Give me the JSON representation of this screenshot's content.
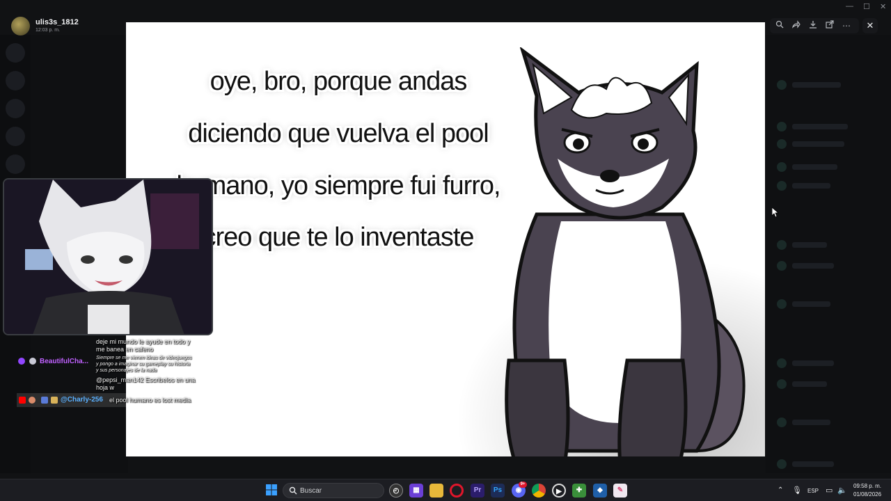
{
  "viewer": {
    "uploader_name": "ulis3s_1812",
    "uploader_time": "12:03 p. m.",
    "actions": [
      "zoom-icon",
      "forward-icon",
      "download-icon",
      "open-external-icon",
      "more-icon"
    ],
    "close_icon": "close-icon"
  },
  "media": {
    "caption_lines": [
      "oye, bro, porque andas",
      "diciendo que vuelva el pool",
      "humano, yo siempre fui furro,",
      "creo que te lo inventaste"
    ]
  },
  "chat": {
    "messages": [
      {
        "text": "deje mi mundo le ayude en todo y"
      },
      {
        "text": "me banea en cafeno"
      },
      {
        "user": "BeautifulCha...",
        "user_color": "#c061ff"
      },
      {
        "text": "Siempre se me vienen ideas de videojuegos"
      },
      {
        "text": "y pongo a imaginar su gameplay su historia"
      },
      {
        "text": "y sus personajes de la nada"
      },
      {
        "text": "@pepsi_man142 Escribelos en una"
      },
      {
        "text": "hoja w"
      },
      {
        "user": "@Charly-256",
        "user_color": "#5ab0ff",
        "text": "el pool humano es lost media"
      }
    ]
  },
  "taskbar": {
    "search_placeholder": "Buscar",
    "language": "ESP",
    "time": "09:58 p. m.",
    "date": "01/08/2026",
    "apps": [
      "windows-start-icon",
      "widgets-icon",
      "app-grid-icon",
      "file-explorer-icon",
      "opera-icon",
      "premiere-icon",
      "photoshop-icon",
      "discord-icon",
      "chrome-icon",
      "media-player-icon",
      "greenshot-icon",
      "sourcetree-icon",
      "paint-icon"
    ],
    "discord_badge": "9+"
  },
  "colors": {
    "accent": "#5865f2",
    "premiere": "#2b1d6b",
    "photoshop": "#1d2c57",
    "opera": "#e0162b"
  }
}
